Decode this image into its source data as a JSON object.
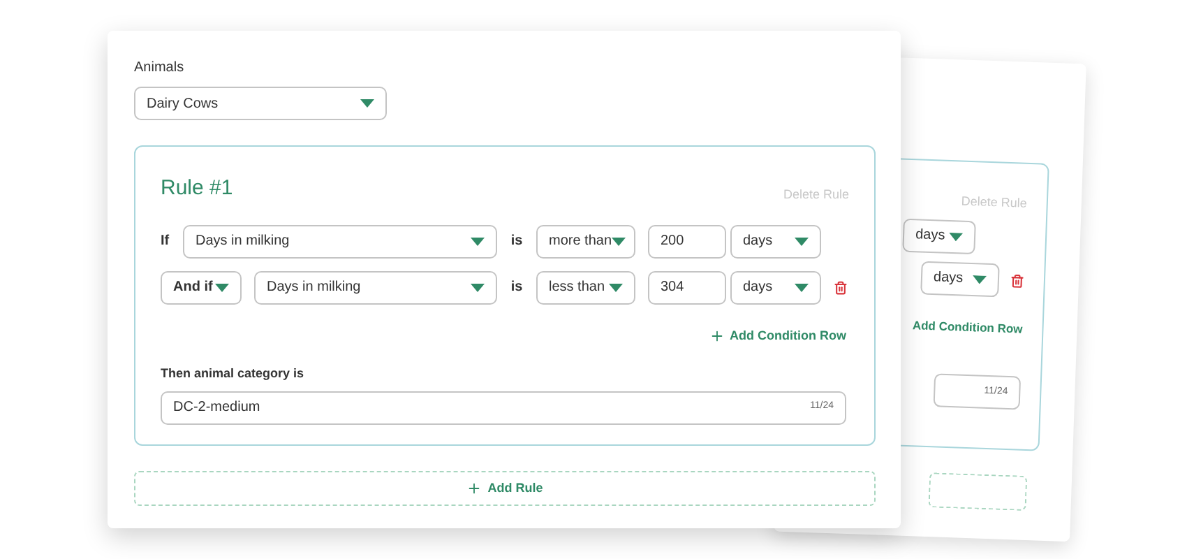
{
  "animals": {
    "label": "Animals",
    "value": "Dairy Cows"
  },
  "rule": {
    "title": "Rule #1",
    "delete": "Delete Rule",
    "conditions": [
      {
        "kind": "label",
        "connector": "If",
        "field": "Days in milking",
        "is": "is",
        "operator": "more than",
        "value": "200",
        "unit": "days",
        "deletable": false
      },
      {
        "kind": "select",
        "connector": "And if",
        "field": "Days in milking",
        "is": "is",
        "operator": "less than",
        "value": "304",
        "unit": "days",
        "deletable": true
      }
    ],
    "add_condition": "Add Condition Row",
    "result_label": "Then animal category is",
    "result_value": "DC-2-medium",
    "counter": "11/24"
  },
  "add_rule": "Add Rule",
  "back_card": {
    "delete": "Delete Rule",
    "conditions": [
      {
        "unit": "days",
        "deletable": false
      },
      {
        "unit": "days",
        "deletable": true
      }
    ],
    "add_condition": "Add Condition Row",
    "counter": "11/24"
  }
}
